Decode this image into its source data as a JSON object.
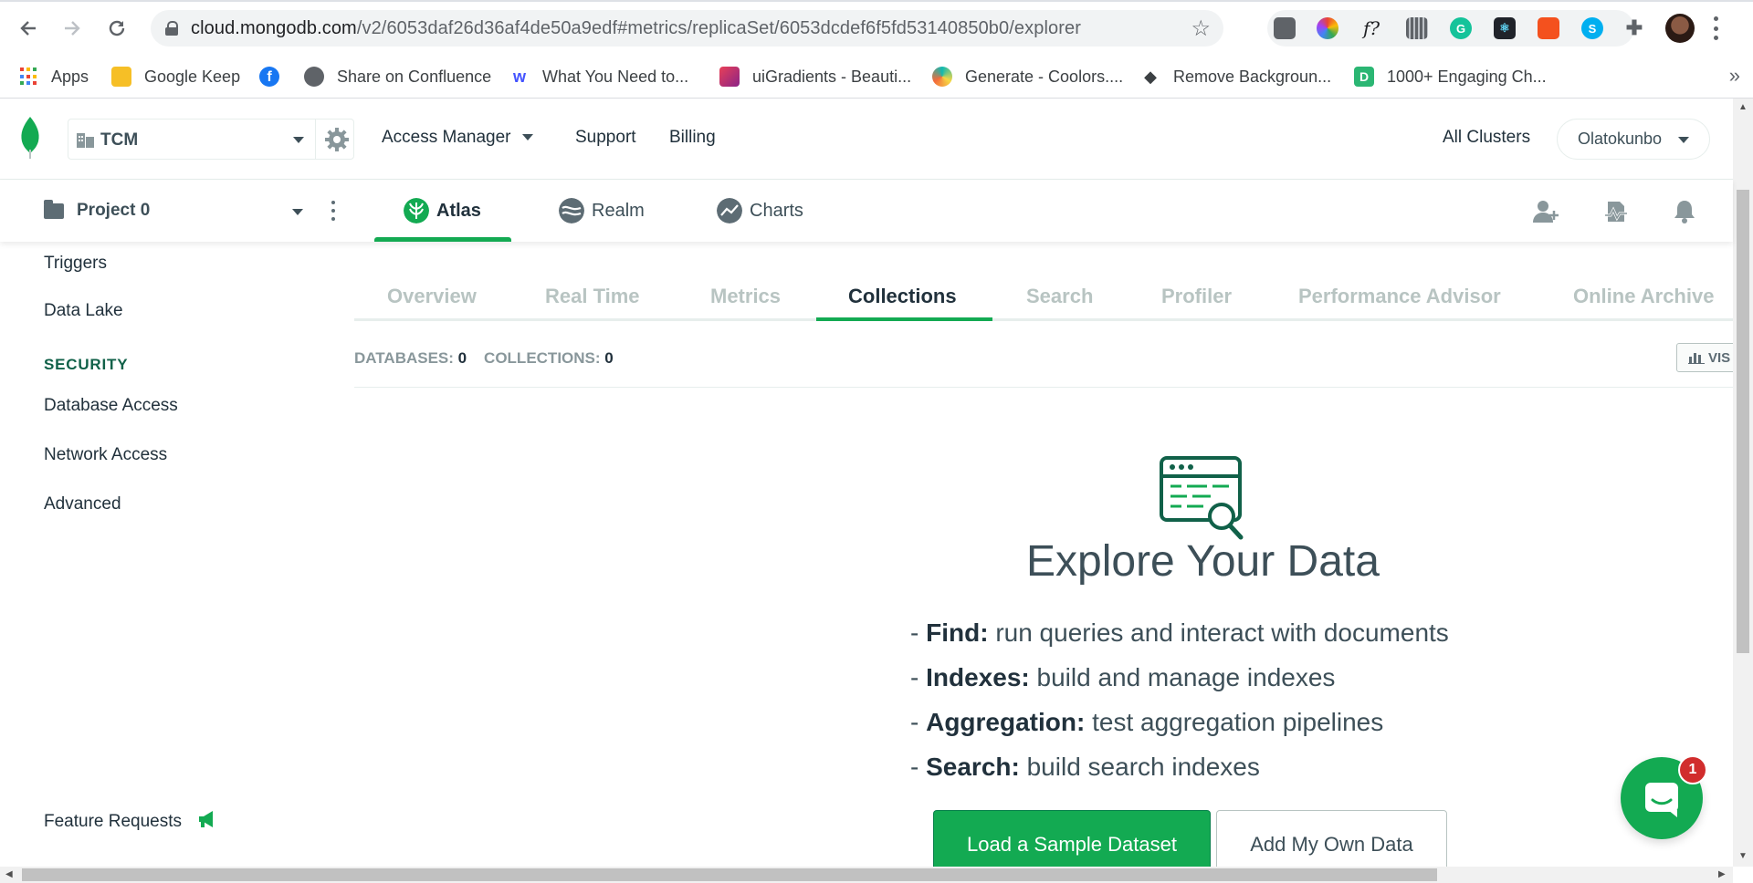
{
  "browser": {
    "url_host": "cloud.mongodb.com",
    "url_path": "/v2/6053daf26d36af4de50a9edf#metrics/replicaSet/6053dcdef6f5fd53140850b0/explorer",
    "bookmarks": [
      {
        "label": "Apps",
        "icon": "apps-grid-icon"
      },
      {
        "label": "Google Keep",
        "icon": "google-keep-icon",
        "color": "#f6bf26"
      },
      {
        "label": "",
        "icon": "facebook-icon",
        "color": "#1877f2"
      },
      {
        "label": "Share on Confluence",
        "icon": "globe-icon",
        "color": "#5f6368"
      },
      {
        "label": "What You Need to...",
        "icon": "webflow-icon",
        "color": "#4353ff"
      },
      {
        "label": "uiGradients - Beauti...",
        "icon": "uigradients-icon",
        "color": "#b23a7a"
      },
      {
        "label": "Generate - Coolors....",
        "icon": "coolors-icon",
        "color": "#0fb9b1"
      },
      {
        "label": "Remove Backgroun...",
        "icon": "layers-icon",
        "color": "#3c4043"
      },
      {
        "label": "1000+ Engaging Ch...",
        "icon": "doc-icon",
        "color": "#2bb673"
      }
    ]
  },
  "topnav": {
    "org_name": "TCM",
    "links": [
      "Access Manager",
      "Support",
      "Billing"
    ],
    "all_clusters": "All Clusters",
    "user": "Olatokunbo"
  },
  "projnav": {
    "project_name": "Project 0",
    "products": [
      {
        "label": "Atlas",
        "icon": "atlas-icon",
        "active": true
      },
      {
        "label": "Realm",
        "icon": "realm-icon",
        "active": false
      },
      {
        "label": "Charts",
        "icon": "charts-icon",
        "active": false
      }
    ]
  },
  "sidebar": {
    "items_top": [
      "Triggers",
      "Data Lake"
    ],
    "security_heading": "SECURITY",
    "security_items": [
      "Database Access",
      "Network Access",
      "Advanced"
    ],
    "feature_requests": "Feature Requests"
  },
  "tabs": [
    "Overview",
    "Real Time",
    "Metrics",
    "Collections",
    "Search",
    "Profiler",
    "Performance Advisor",
    "Online Archive"
  ],
  "active_tab": "Collections",
  "stats": {
    "databases_label": "DATABASES:",
    "databases_value": "0",
    "collections_label": "COLLECTIONS:",
    "collections_value": "0",
    "vis_label": "VIS"
  },
  "hero": {
    "title": "Explore Your Data",
    "features": [
      {
        "name": "Find:",
        "desc": "run queries and interact with documents"
      },
      {
        "name": "Indexes:",
        "desc": "build and manage indexes"
      },
      {
        "name": "Aggregation:",
        "desc": "test aggregation pipelines"
      },
      {
        "name": "Search:",
        "desc": "build search indexes"
      }
    ],
    "primary_button": "Load a Sample Dataset",
    "secondary_button": "Add My Own Data"
  },
  "chat": {
    "badge": "1"
  },
  "colors": {
    "brand_green": "#13aa52",
    "dark_green": "#116149",
    "badge_red": "#d12d2d"
  }
}
